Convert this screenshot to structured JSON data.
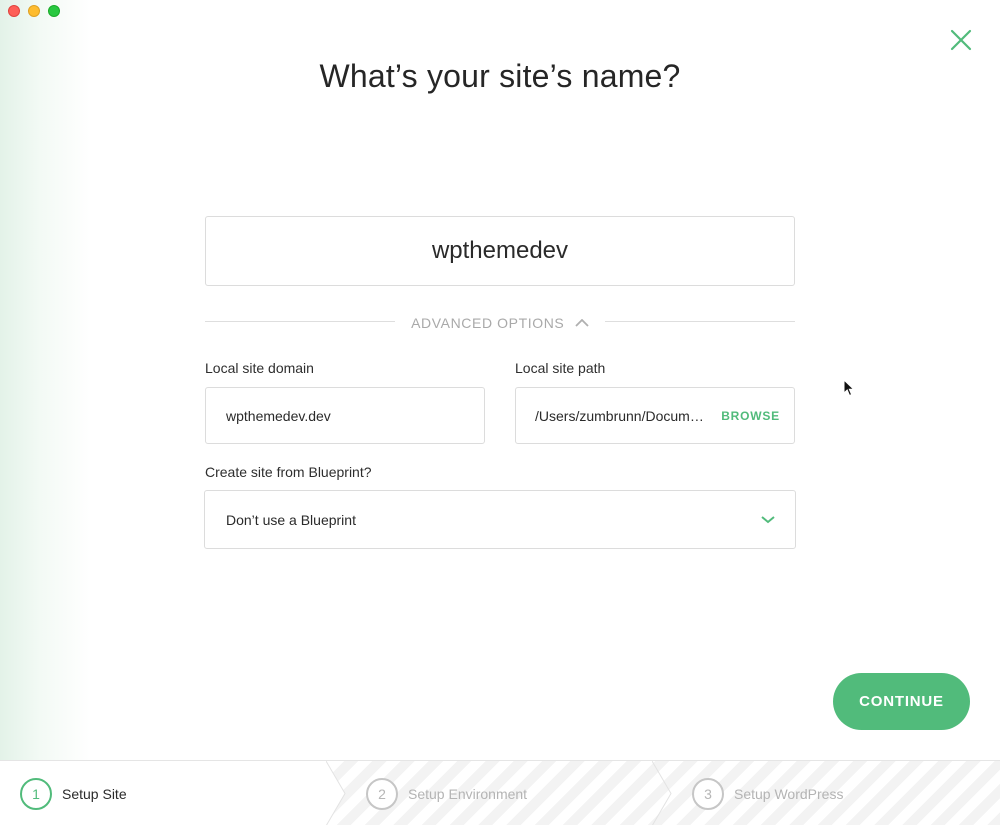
{
  "window": {
    "title": "What’s your site’s name?"
  },
  "site_name": {
    "value": "wpthemedev"
  },
  "advanced": {
    "label": "ADVANCED OPTIONS",
    "icon": "chevron-up-icon"
  },
  "domain": {
    "label": "Local site domain",
    "value": "wpthemedev.dev"
  },
  "path": {
    "label": "Local site path",
    "value": "/Users/zumbrunn/Documents/Local Sites/wpthemedev",
    "browse_label": "BROWSE"
  },
  "blueprint": {
    "label": "Create site from Blueprint?",
    "selected": "Don’t use a Blueprint",
    "icon": "chevron-down-icon"
  },
  "actions": {
    "continue_label": "CONTINUE",
    "close_icon": "close-icon"
  },
  "steps": [
    {
      "number": "1",
      "label": "Setup Site",
      "active": true
    },
    {
      "number": "2",
      "label": "Setup Environment",
      "active": false
    },
    {
      "number": "3",
      "label": "Setup WordPress",
      "active": false
    }
  ],
  "colors": {
    "accent": "#51bb7b",
    "border": "#dcdcdc",
    "muted": "#a9a9a9"
  }
}
